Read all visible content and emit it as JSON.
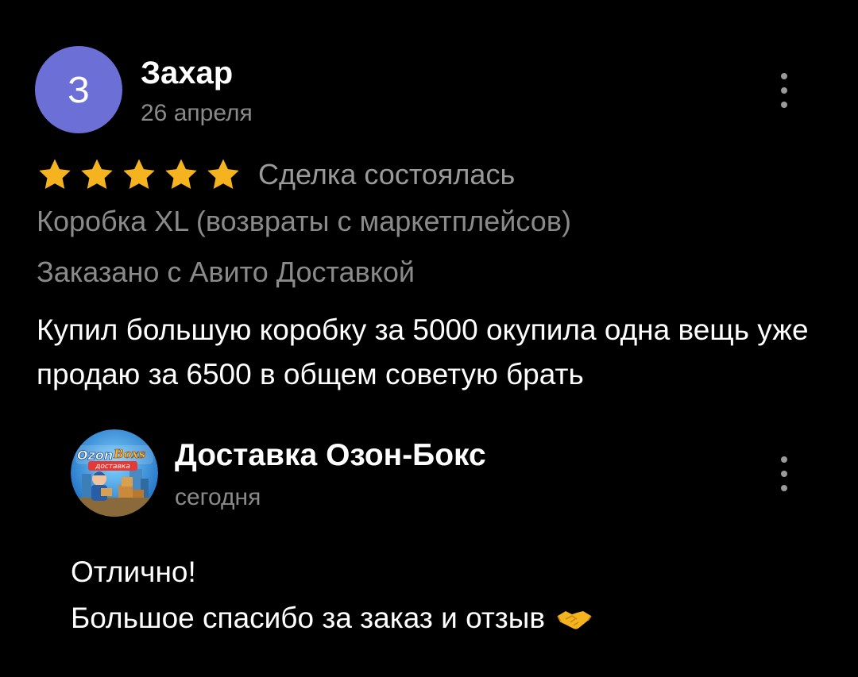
{
  "review": {
    "avatar_letter": "З",
    "author_name": "Захар",
    "date": "26 апреля",
    "rating": 5,
    "rating_max": 5,
    "deal_status": "Сделка состоялась",
    "product": "Коробка XL (возвраты с маркетплейсов)",
    "delivery": "Заказано с Авито Доставкой",
    "text": "Купил большую коробку за 5000 окупила одна вещь уже продаю за 6500 в общем советую брать"
  },
  "reply": {
    "seller_name": "Доставка Озон-Бокс",
    "date": "сегодня",
    "line1": "Отлично!",
    "line2": "Большое спасибо за заказ и отзыв",
    "emoji": "handshake-icon",
    "logo_text_1": "Ozon",
    "logo_text_2": "Boxs",
    "logo_text_3": "доставка"
  },
  "colors": {
    "background": "#000000",
    "avatar": "#6c6fd6",
    "star": "#f5b31f",
    "secondary_text": "#8a8a8a"
  }
}
